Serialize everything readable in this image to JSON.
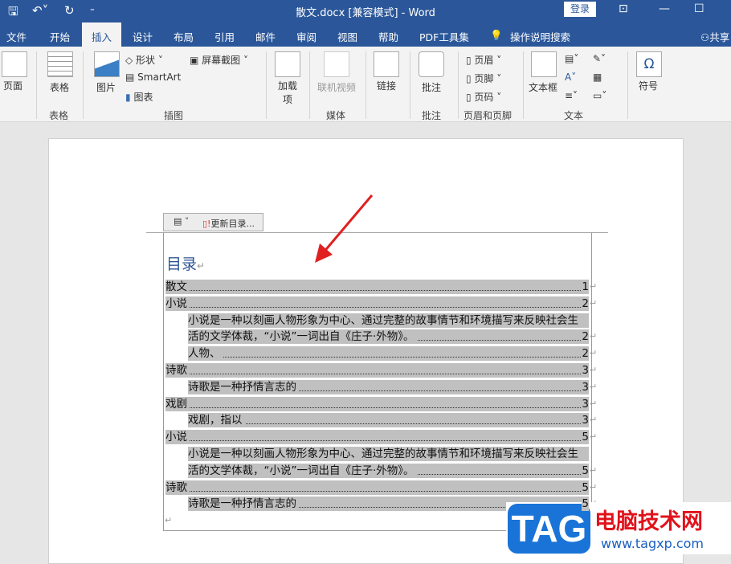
{
  "titlebar": {
    "title": "散文.docx [兼容模式]  -  Word",
    "login": "登录",
    "icons": [
      "save-icon",
      "undo-icon",
      "redo-icon",
      "customize-icon",
      "ribbon-display-icon",
      "minimize-icon",
      "maximize-icon"
    ]
  },
  "tabs": [
    {
      "label": "文件"
    },
    {
      "label": "开始"
    },
    {
      "label": "插入",
      "active": true
    },
    {
      "label": "设计"
    },
    {
      "label": "布局"
    },
    {
      "label": "引用"
    },
    {
      "label": "邮件"
    },
    {
      "label": "审阅"
    },
    {
      "label": "视图"
    },
    {
      "label": "帮助"
    },
    {
      "label": "PDF工具集"
    },
    {
      "label": "操作说明搜索"
    },
    {
      "label": "共享"
    }
  ],
  "ribbon": {
    "page": "页面",
    "table": "表格",
    "picture": "图片",
    "shapes": "形状",
    "smartart": "SmartArt",
    "chart": "图表",
    "screenshot": "屏幕截图",
    "addins": "加载项",
    "online_video": "联机视频",
    "link": "链接",
    "comment": "批注",
    "header": "页眉",
    "footer": "页脚",
    "page_number": "页码",
    "textbox": "文本框",
    "symbol": "符号",
    "groups": {
      "table": "表格",
      "illustrations": "插图",
      "media": "媒体",
      "comments": "批注",
      "header_footer": "页眉和页脚",
      "text": "文本"
    }
  },
  "toc_toolbar": {
    "update": "更新目录..."
  },
  "toc": {
    "heading": "目录",
    "rows": [
      {
        "text": "散文",
        "page": "1",
        "level": 1
      },
      {
        "text": "小说",
        "page": "2",
        "level": 1
      },
      {
        "text": "小说是一种以刻画人物形象为中心、通过完整的故事情节和环境描写来反映社会生",
        "page": "",
        "level": 2,
        "wrap": true
      },
      {
        "text": "活的文学体裁，“小说”一词出自《庄子·外物》。",
        "page": "2",
        "level": 2
      },
      {
        "text": "人物、",
        "page": "2",
        "level": 2
      },
      {
        "text": "诗歌",
        "page": "3",
        "level": 1
      },
      {
        "text": "诗歌是一种抒情言志的",
        "page": "3",
        "level": 2
      },
      {
        "text": "戏剧",
        "page": "3",
        "level": 1
      },
      {
        "text": "戏剧，指以",
        "page": "3",
        "level": 2
      },
      {
        "text": "小说",
        "page": "5",
        "level": 1
      },
      {
        "text": "小说是一种以刻画人物形象为中心、通过完整的故事情节和环境描写来反映社会生",
        "page": "",
        "level": 2,
        "wrap": true
      },
      {
        "text": "活的文学体裁，“小说”一词出自《庄子·外物》。",
        "page": "5",
        "level": 2
      },
      {
        "text": "诗歌",
        "page": "5",
        "level": 1
      },
      {
        "text": "诗歌是一种抒情言志的",
        "page": "5",
        "level": 2
      }
    ]
  },
  "watermark": {
    "logo": "TAG",
    "name": "电脑技术网",
    "url": "www.tagxp.com"
  },
  "colors": {
    "brand": "#2b579a",
    "arrow": "#e02020",
    "heading": "#2f5496",
    "highlight": "#c0c0c0"
  }
}
